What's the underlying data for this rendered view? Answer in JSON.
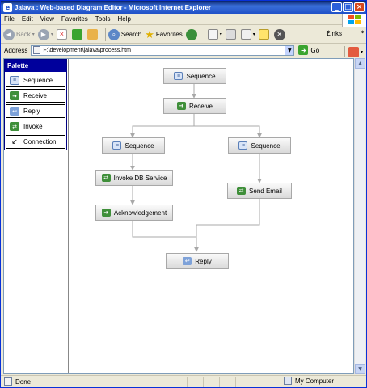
{
  "window": {
    "title": "Jalava : Web-based Diagram Editor - Microsoft Internet Explorer"
  },
  "menu": [
    "File",
    "Edit",
    "View",
    "Favorites",
    "Tools",
    "Help"
  ],
  "toolbar": {
    "back": "Back",
    "search": "Search",
    "favorites": "Favorites",
    "links": "Links"
  },
  "address": {
    "label": "Address",
    "value": "F:\\development\\jalava\\process.htm",
    "go": "Go"
  },
  "palette": {
    "header": "Palette",
    "items": [
      "Sequence",
      "Receive",
      "Reply",
      "Invoke",
      "Connection"
    ]
  },
  "diagram": {
    "nodes": [
      "Sequence",
      "Receive",
      "Sequence",
      "Sequence",
      "Invoke DB Service",
      "Send Email",
      "Acknowledgement",
      "Reply"
    ]
  },
  "status": {
    "left": "Done",
    "right": "My Computer"
  },
  "colors": {
    "palette_header": "#00009c",
    "node_fill": "#e8e8e8",
    "edge": "#a8a8a8"
  }
}
